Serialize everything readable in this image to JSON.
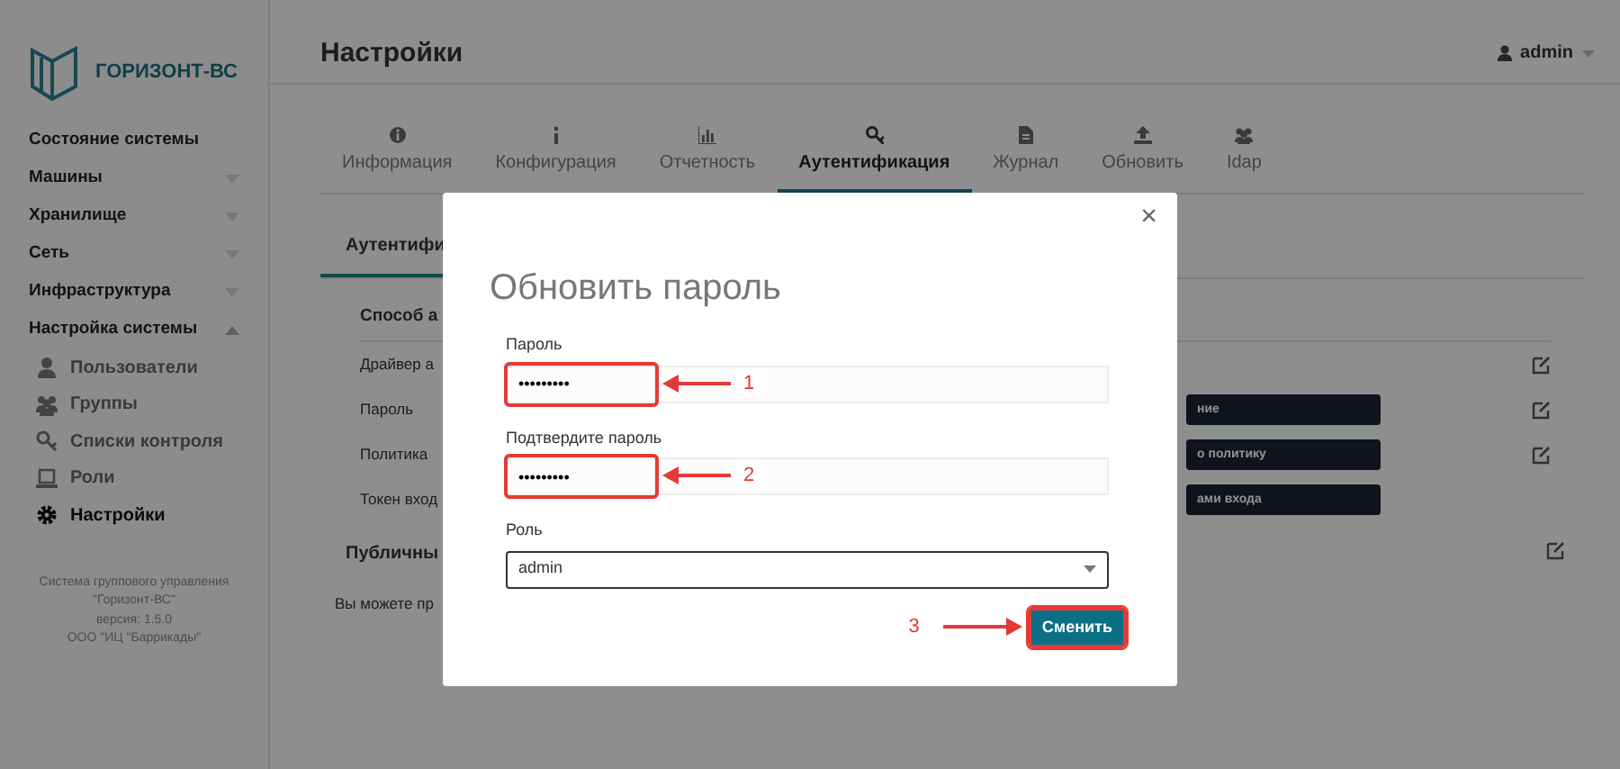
{
  "sidebar": {
    "logo_text": "ГОРИЗОНТ-ВС",
    "items": [
      {
        "kind": "link",
        "label": "Состояние системы"
      },
      {
        "kind": "group",
        "label": "Машины",
        "expanded": false
      },
      {
        "kind": "group",
        "label": "Хранилище",
        "expanded": false
      },
      {
        "kind": "group",
        "label": "Сеть",
        "expanded": false
      },
      {
        "kind": "group",
        "label": "Инфраструктура",
        "expanded": false
      },
      {
        "kind": "group",
        "label": "Настройка системы",
        "expanded": true,
        "children": [
          {
            "label": "Пользователи",
            "selected": false
          },
          {
            "label": "Группы",
            "selected": false
          },
          {
            "label": "Списки контроля",
            "selected": false
          },
          {
            "label": "Роли",
            "selected": false
          },
          {
            "label": "Настройки",
            "selected": true
          }
        ]
      }
    ],
    "footer": [
      "Система группового управления",
      "\"Горизонт-ВС\"",
      "версия: 1.5.0",
      "ООО \"ИЦ \"Баррикады\""
    ]
  },
  "header": {
    "title": "Настройки",
    "user": "admin"
  },
  "tabs": [
    {
      "label": "Информация",
      "selected": false
    },
    {
      "label": "Конфигурация",
      "selected": false
    },
    {
      "label": "Отчетность",
      "selected": false
    },
    {
      "label": "Аутентификация",
      "selected": true
    },
    {
      "label": "Журнал",
      "selected": false
    },
    {
      "label": "Обновить",
      "selected": false
    },
    {
      "label": "Idap",
      "selected": false
    }
  ],
  "subtab": "Аутентифи",
  "section": {
    "title": "Способ а",
    "rows": [
      {
        "label": "Драйвер а",
        "button": null,
        "editable": true
      },
      {
        "label": "Пароль",
        "button": "ние",
        "editable": true
      },
      {
        "label": "Политика",
        "button": "о политику",
        "editable": true
      },
      {
        "label": "Токен вход",
        "button": "ами входа",
        "editable": false
      }
    ]
  },
  "public": {
    "title": "Публичны",
    "text": "Вы можете пр"
  },
  "modal": {
    "title": "Обновить пароль",
    "close": "×",
    "fields": [
      {
        "kind": "text",
        "label": "Пароль",
        "value": "•••••••••",
        "annotation": "1"
      },
      {
        "kind": "text",
        "label": "Подтвердите пароль",
        "value": "•••••••••",
        "annotation": "2"
      },
      {
        "kind": "select",
        "label": "Роль",
        "value": "admin"
      }
    ],
    "button": {
      "label": "Сменить",
      "annotation": "3"
    }
  }
}
